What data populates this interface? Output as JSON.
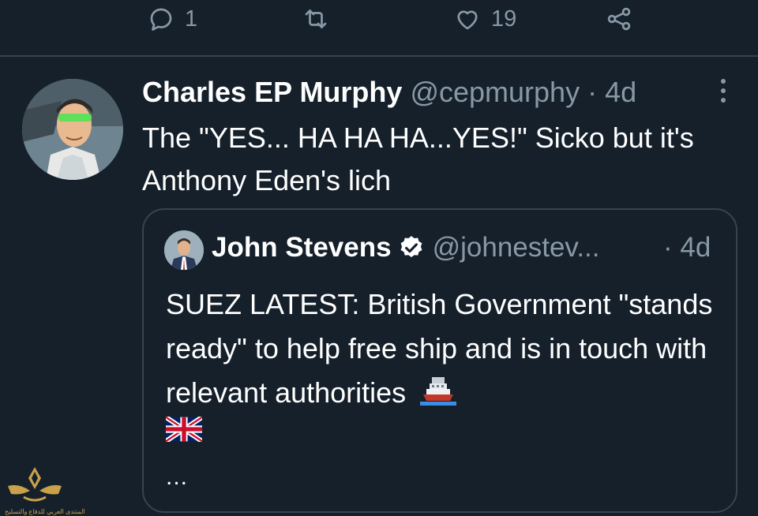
{
  "actions": {
    "reply_count": "1",
    "like_count": "19"
  },
  "tweet": {
    "author_name": "Charles EP Murphy",
    "handle": "@cepmurphy",
    "separator": "·",
    "time": "4d",
    "text": "The \"YES... HA HA HA...YES!\" Sicko but it's Anthony Eden's lich"
  },
  "quoted": {
    "author_name": "John Stevens",
    "handle": "@johnestev...",
    "separator": "·",
    "time": "4d",
    "text": "SUEZ LATEST: British Government \"stands ready\" to help free ship and is in touch with relevant authorities",
    "more": "..."
  },
  "watermark": {
    "text": "المنتدى العربي للدفاع والتسليح"
  },
  "colors": {
    "background": "#15202b",
    "secondary_text": "#8899a6",
    "border": "#38444d",
    "verified": "#ffffff"
  },
  "icons": [
    "reply-icon",
    "retweet-icon",
    "like-icon",
    "share-icon",
    "more-icon",
    "verified-icon",
    "ship-icon",
    "uk-flag-icon"
  ]
}
